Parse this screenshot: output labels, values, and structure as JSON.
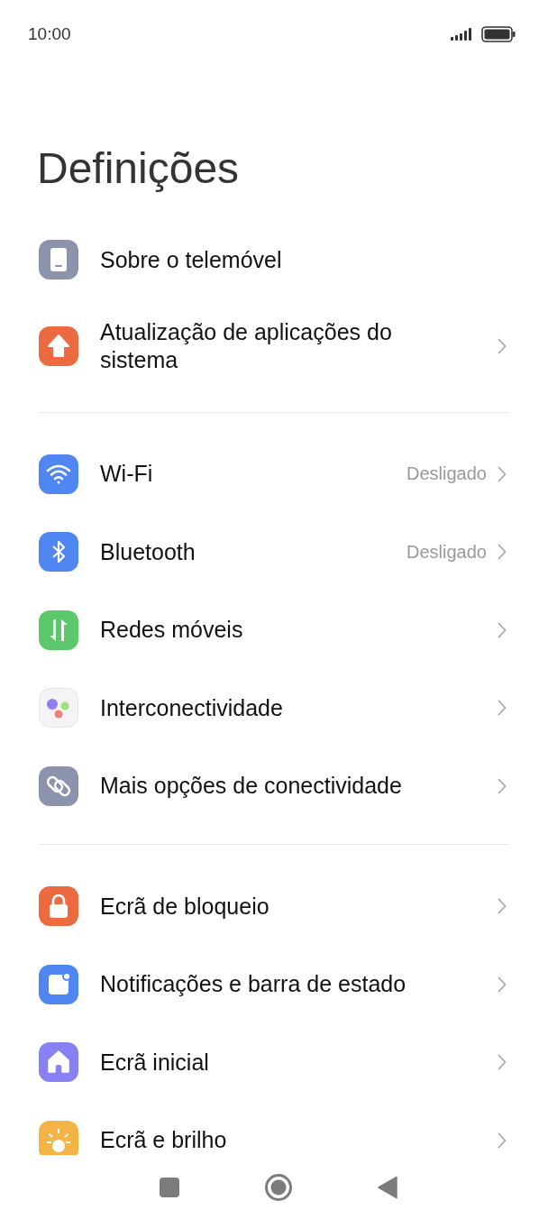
{
  "status_bar": {
    "time": "10:00"
  },
  "title": "Definições",
  "sections": [
    {
      "items": [
        {
          "label": "Sobre o telemóvel",
          "chevron": false
        },
        {
          "label": "Atualização de aplicações do sistema",
          "chevron": true
        }
      ]
    },
    {
      "items": [
        {
          "label": "Wi-Fi",
          "value": "Desligado",
          "chevron": true
        },
        {
          "label": "Bluetooth",
          "value": "Desligado",
          "chevron": true
        },
        {
          "label": "Redes móveis",
          "chevron": true
        },
        {
          "label": "Interconectividade",
          "chevron": true
        },
        {
          "label": "Mais opções de conectividade",
          "chevron": true
        }
      ]
    },
    {
      "items": [
        {
          "label": "Ecrã de bloqueio",
          "chevron": true
        },
        {
          "label": "Notificações e barra de estado",
          "chevron": true
        },
        {
          "label": "Ecrã inicial",
          "chevron": true
        },
        {
          "label": "Ecrã e brilho",
          "chevron": true
        }
      ]
    }
  ]
}
